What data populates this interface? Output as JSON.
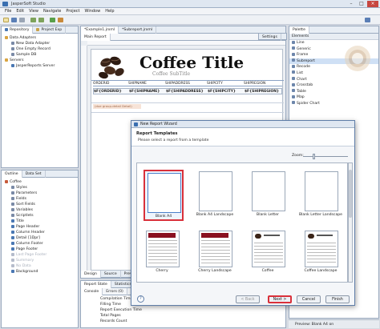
{
  "window": {
    "title": "JasperSoft Studio"
  },
  "menu": [
    "File",
    "Edit",
    "View",
    "Navigate",
    "Project",
    "Window",
    "Help"
  ],
  "left_top": {
    "tabs": [
      "Repository",
      "Project Exp"
    ],
    "tree": [
      {
        "label": "Data Adapters",
        "level": 0,
        "color": "#d9a441"
      },
      {
        "label": "New Data Adapter",
        "level": 1,
        "color": "#7a8aa6"
      },
      {
        "label": "One Empty Record",
        "level": 1,
        "color": "#7a8aa6"
      },
      {
        "label": "Sample DB",
        "level": 1,
        "color": "#7a8aa6"
      },
      {
        "label": "Servers",
        "level": 0,
        "color": "#d9a441"
      },
      {
        "label": "JasperReports Server",
        "level": 1,
        "color": "#4a78b3"
      }
    ]
  },
  "editor": {
    "tabs": [
      "*Example1.jrxml",
      "*Subreport.jrxml"
    ],
    "subtabs": [
      "Main Report"
    ],
    "report_title": "Coffee Title",
    "report_subtitle": "Coffee SubTitle",
    "column_headers": [
      "ORDERID",
      "SHIPNAME",
      "SHIPADDRESS",
      "SHIPCITY",
      "SHIPREGION"
    ],
    "field_row": [
      "$F{ORDERID}",
      "$F{SHIPNAME}",
      "$F{SHIPADDRESS}",
      "$F{SHIPCITY}",
      "$F{SHIPREGION}"
    ],
    "detail_note": "(due group-detail Detail)",
    "bottom_tabs": [
      "Design",
      "Source",
      "Preview"
    ]
  },
  "settings_tab": "Settings",
  "outline": {
    "tabs": [
      "Outline",
      "Data Set"
    ],
    "items": [
      {
        "label": "Coffee",
        "level": 0,
        "color": "#c75a3a"
      },
      {
        "label": "Styles",
        "level": 1,
        "color": "#7a8aa6"
      },
      {
        "label": "Parameters",
        "level": 1,
        "color": "#7a8aa6"
      },
      {
        "label": "Fields",
        "level": 1,
        "color": "#7a8aa6"
      },
      {
        "label": "Sort Fields",
        "level": 1,
        "color": "#7a8aa6"
      },
      {
        "label": "Variables",
        "level": 1,
        "color": "#7a8aa6"
      },
      {
        "label": "Scriptlets",
        "level": 1,
        "color": "#7a8aa6"
      },
      {
        "label": "Title",
        "level": 1,
        "color": "#4a78b3"
      },
      {
        "label": "Page Header",
        "level": 1,
        "color": "#4a78b3"
      },
      {
        "label": "Column Header",
        "level": 1,
        "color": "#4a78b3"
      },
      {
        "label": "Detail [1Dpr]",
        "level": 1,
        "color": "#4a78b3"
      },
      {
        "label": "Column Footer",
        "level": 1,
        "color": "#4a78b3"
      },
      {
        "label": "Page Footer",
        "level": 1,
        "color": "#4a78b3"
      },
      {
        "label": "Last Page Footer",
        "level": 1,
        "color": "#b5bccb",
        "dim": true
      },
      {
        "label": "Summary",
        "level": 1,
        "color": "#b5bccb",
        "dim": true
      },
      {
        "label": "No Data",
        "level": 1,
        "color": "#b5bccb",
        "dim": true
      },
      {
        "label": "Background",
        "level": 1,
        "color": "#4a78b3"
      }
    ]
  },
  "report_state": {
    "tabs": [
      "Report State",
      "Statistics"
    ],
    "subtabs": [
      "Console",
      "Errors (0)",
      "Statistics"
    ],
    "rows": [
      "Compilation Time",
      "Filling Time",
      "Report Execution Time",
      "Total Pages",
      "Records Count"
    ]
  },
  "palette": {
    "title": "Palette",
    "section": "Elements",
    "items": [
      "Line",
      "Generic",
      "Frame",
      "Subreport",
      "Recode",
      "List",
      "Chart",
      "Crosstab",
      "Table",
      "Map",
      "Spider Chart"
    ],
    "selected": "Subreport"
  },
  "dialog": {
    "title": "New Report Wizard",
    "heading": "Report Templates",
    "subheading": "Please select a report from a template",
    "zoom_label": "Zoom:",
    "templates": [
      {
        "label": "Blank A4",
        "style": "blank",
        "selected": true
      },
      {
        "label": "Blank A4 Landscape",
        "style": "blank"
      },
      {
        "label": "Blank Letter",
        "style": "blank"
      },
      {
        "label": "Blank Letter Landscape",
        "style": "blank"
      },
      {
        "label": "Cherry",
        "style": "cherry"
      },
      {
        "label": "Cherry Landscape",
        "style": "cherry"
      },
      {
        "label": "Coffee",
        "style": "coffee"
      },
      {
        "label": "Coffee Landscape",
        "style": "coffee"
      }
    ],
    "help_label": "?",
    "back_label": "< Back",
    "next_label": "Next >",
    "cancel_label": "Cancel",
    "finish_label": "Finish",
    "highlight_color": "#d9303a"
  },
  "status_bar": {
    "text": "Preview: Blank A4 on"
  }
}
